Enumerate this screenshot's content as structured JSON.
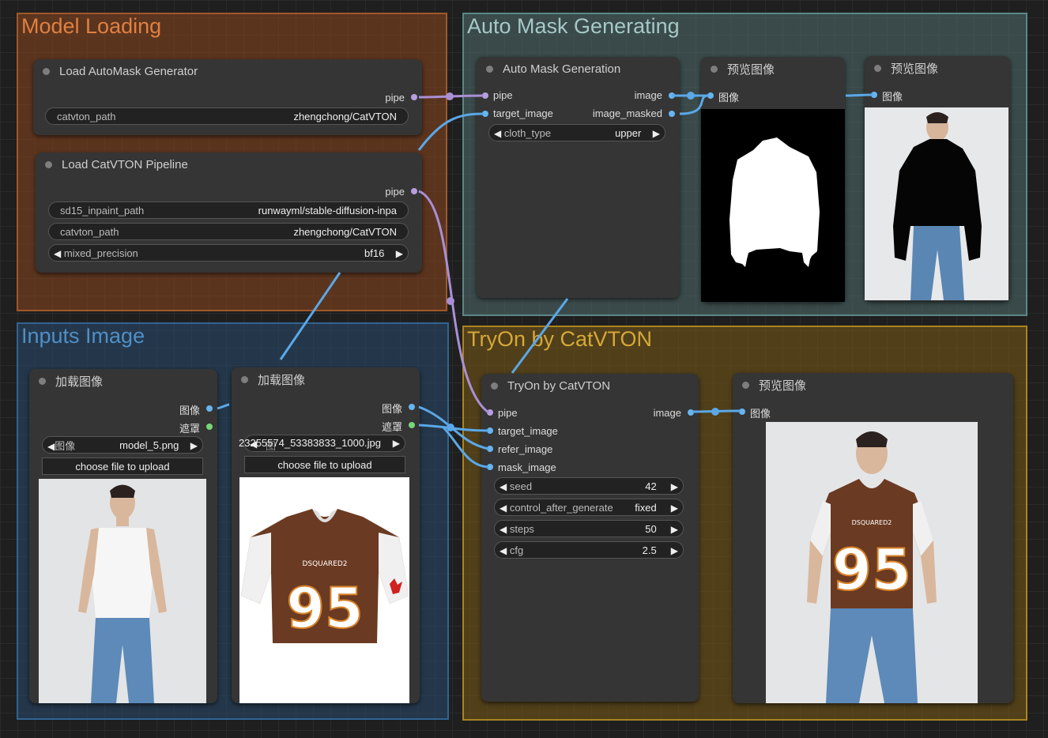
{
  "groups": {
    "model_loading": "Model Loading",
    "auto_mask": "Auto Mask Generating",
    "inputs": "Inputs Image",
    "tryon": "TryOn by CatVTON"
  },
  "nodes": {
    "automask_loader": {
      "title": "Load AutoMask Generator",
      "output": "pipe",
      "widgets": [
        {
          "label": "catvton_path",
          "value": "zhengchong/CatVTON"
        }
      ]
    },
    "catvton_loader": {
      "title": "Load CatVTON Pipeline",
      "output": "pipe",
      "widgets": [
        {
          "label": "sd15_inpaint_path",
          "value": "runwayml/stable-diffusion-inpa"
        },
        {
          "label": "catvton_path",
          "value": "zhengchong/CatVTON"
        },
        {
          "label": "mixed_precision",
          "value": "bf16"
        }
      ]
    },
    "auto_mask_gen": {
      "title": "Auto Mask Generation",
      "inputs": [
        "pipe",
        "target_image"
      ],
      "outputs": [
        "image",
        "image_masked"
      ],
      "widgets": [
        {
          "label": "cloth_type",
          "value": "upper"
        }
      ]
    },
    "preview_mask": {
      "title": "预览图像",
      "input": "图像"
    },
    "preview_masked": {
      "title": "预览图像",
      "input": "图像"
    },
    "load_image_1": {
      "title": "加载图像",
      "outputs": [
        "图像",
        "遮罩"
      ],
      "widget": {
        "label": "图像",
        "value": "model_5.png"
      },
      "button": "choose file to upload"
    },
    "load_image_2": {
      "title": "加载图像",
      "outputs": [
        "图像",
        "遮罩"
      ],
      "widget": {
        "label": "图像",
        "value": "23255574_53383833_1000.jpg"
      },
      "button": "choose file to upload"
    },
    "tryon": {
      "title": "TryOn by CatVTON",
      "inputs": [
        "pipe",
        "target_image",
        "refer_image",
        "mask_image"
      ],
      "output": "image",
      "widgets": [
        {
          "label": "seed",
          "value": "42"
        },
        {
          "label": "control_after_generate",
          "value": "fixed"
        },
        {
          "label": "steps",
          "value": "50"
        },
        {
          "label": "cfg",
          "value": "2.5"
        }
      ]
    },
    "preview_result": {
      "title": "预览图像",
      "input": "图像"
    }
  },
  "icons": {
    "arrow_left": "◀",
    "arrow_right": "▶"
  },
  "colors": {
    "pipe_socket": "#b59fe0",
    "image_socket": "#66b5f0",
    "mask_socket": "#76d776",
    "link_pipe": "#a98fd6",
    "link_image": "#5aa8e8"
  }
}
